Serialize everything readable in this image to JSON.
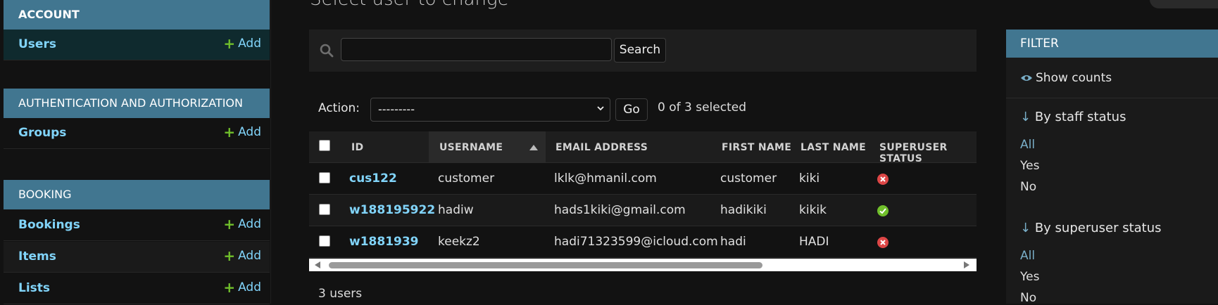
{
  "sidebar": {
    "account_caption": "ACCOUNT",
    "users_label": "Users",
    "add_label": "Add",
    "auth_caption": "AUTHENTICATION AND AUTHORIZATION",
    "groups_label": "Groups",
    "booking_caption": "BOOKING",
    "bookings_label": "Bookings",
    "items_label": "Items",
    "lists_label": "Lists"
  },
  "main": {
    "title": "Select user to change",
    "search_button": "Search",
    "search_value": "",
    "action_label": "Action:",
    "action_value": "---------",
    "go_button": "Go",
    "selected_text": "0 of 3 selected",
    "paginator": "3 users"
  },
  "table": {
    "headers": {
      "id": "ID",
      "username": "USERNAME",
      "email": "EMAIL ADDRESS",
      "first": "FIRST NAME",
      "last": "LAST NAME",
      "superuser": "SUPERUSER STATUS"
    },
    "rows": [
      {
        "id": "cus122",
        "username": "customer",
        "email": "lklk@hmanil.com",
        "first": "customer",
        "last": "kiki",
        "superuser": false
      },
      {
        "id": "w188195922",
        "username": "hadiw",
        "email": "hads1kiki@gmail.com",
        "first": "hadikiki",
        "last": "kikik",
        "superuser": true
      },
      {
        "id": "w1881939",
        "username": "keekz2",
        "email": "hadi71323599@icloud.com",
        "first": "hadi",
        "last": "HADI",
        "superuser": false
      }
    ]
  },
  "filter": {
    "caption": "FILTER",
    "show_counts": "Show counts",
    "staff_heading": "By staff status",
    "superuser_heading": "By superuser status",
    "options": [
      "All",
      "Yes",
      "No"
    ]
  },
  "colors": {
    "caption_bg": "#417690",
    "link": "#81d4fa",
    "add_plus": "#70bf2b",
    "yes_icon": "#70bf2b",
    "no_icon": "#dd4646"
  }
}
